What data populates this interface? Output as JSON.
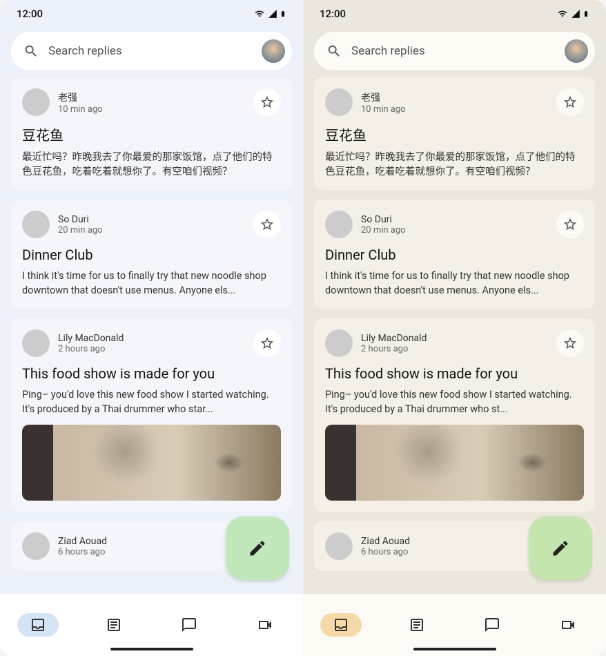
{
  "status": {
    "time": "12:00"
  },
  "search": {
    "placeholder": "Search replies"
  },
  "messages": [
    {
      "name": "老强",
      "time": "10 min ago",
      "title": "豆花鱼",
      "body": "最近忙吗？昨晚我去了你最爱的那家饭馆，点了他们的特色豆花鱼，吃着吃着就想你了。有空咱们视频？",
      "has_thumb": false
    },
    {
      "name": "So Duri",
      "time": "20 min ago",
      "title": "Dinner Club",
      "body": "I think it's time for us to finally try that new noodle shop downtown that doesn't use menus. Anyone els...",
      "has_thumb": false
    },
    {
      "name": "Lily MacDonald",
      "time": "2 hours ago",
      "title": "This food show is made for you",
      "body": "Ping– you'd love this new food show I started watching. It's produced by a Thai drummer who star...",
      "body_alt": "Ping– you'd love this new food show I started watching. It's produced by a Thai drummer who st...",
      "has_thumb": true
    },
    {
      "name": "Ziad Aouad",
      "time": "6 hours ago",
      "title": "",
      "body": "",
      "has_thumb": false
    }
  ],
  "nav": {
    "items": [
      "inbox",
      "article",
      "chat",
      "video"
    ],
    "active": 0
  }
}
